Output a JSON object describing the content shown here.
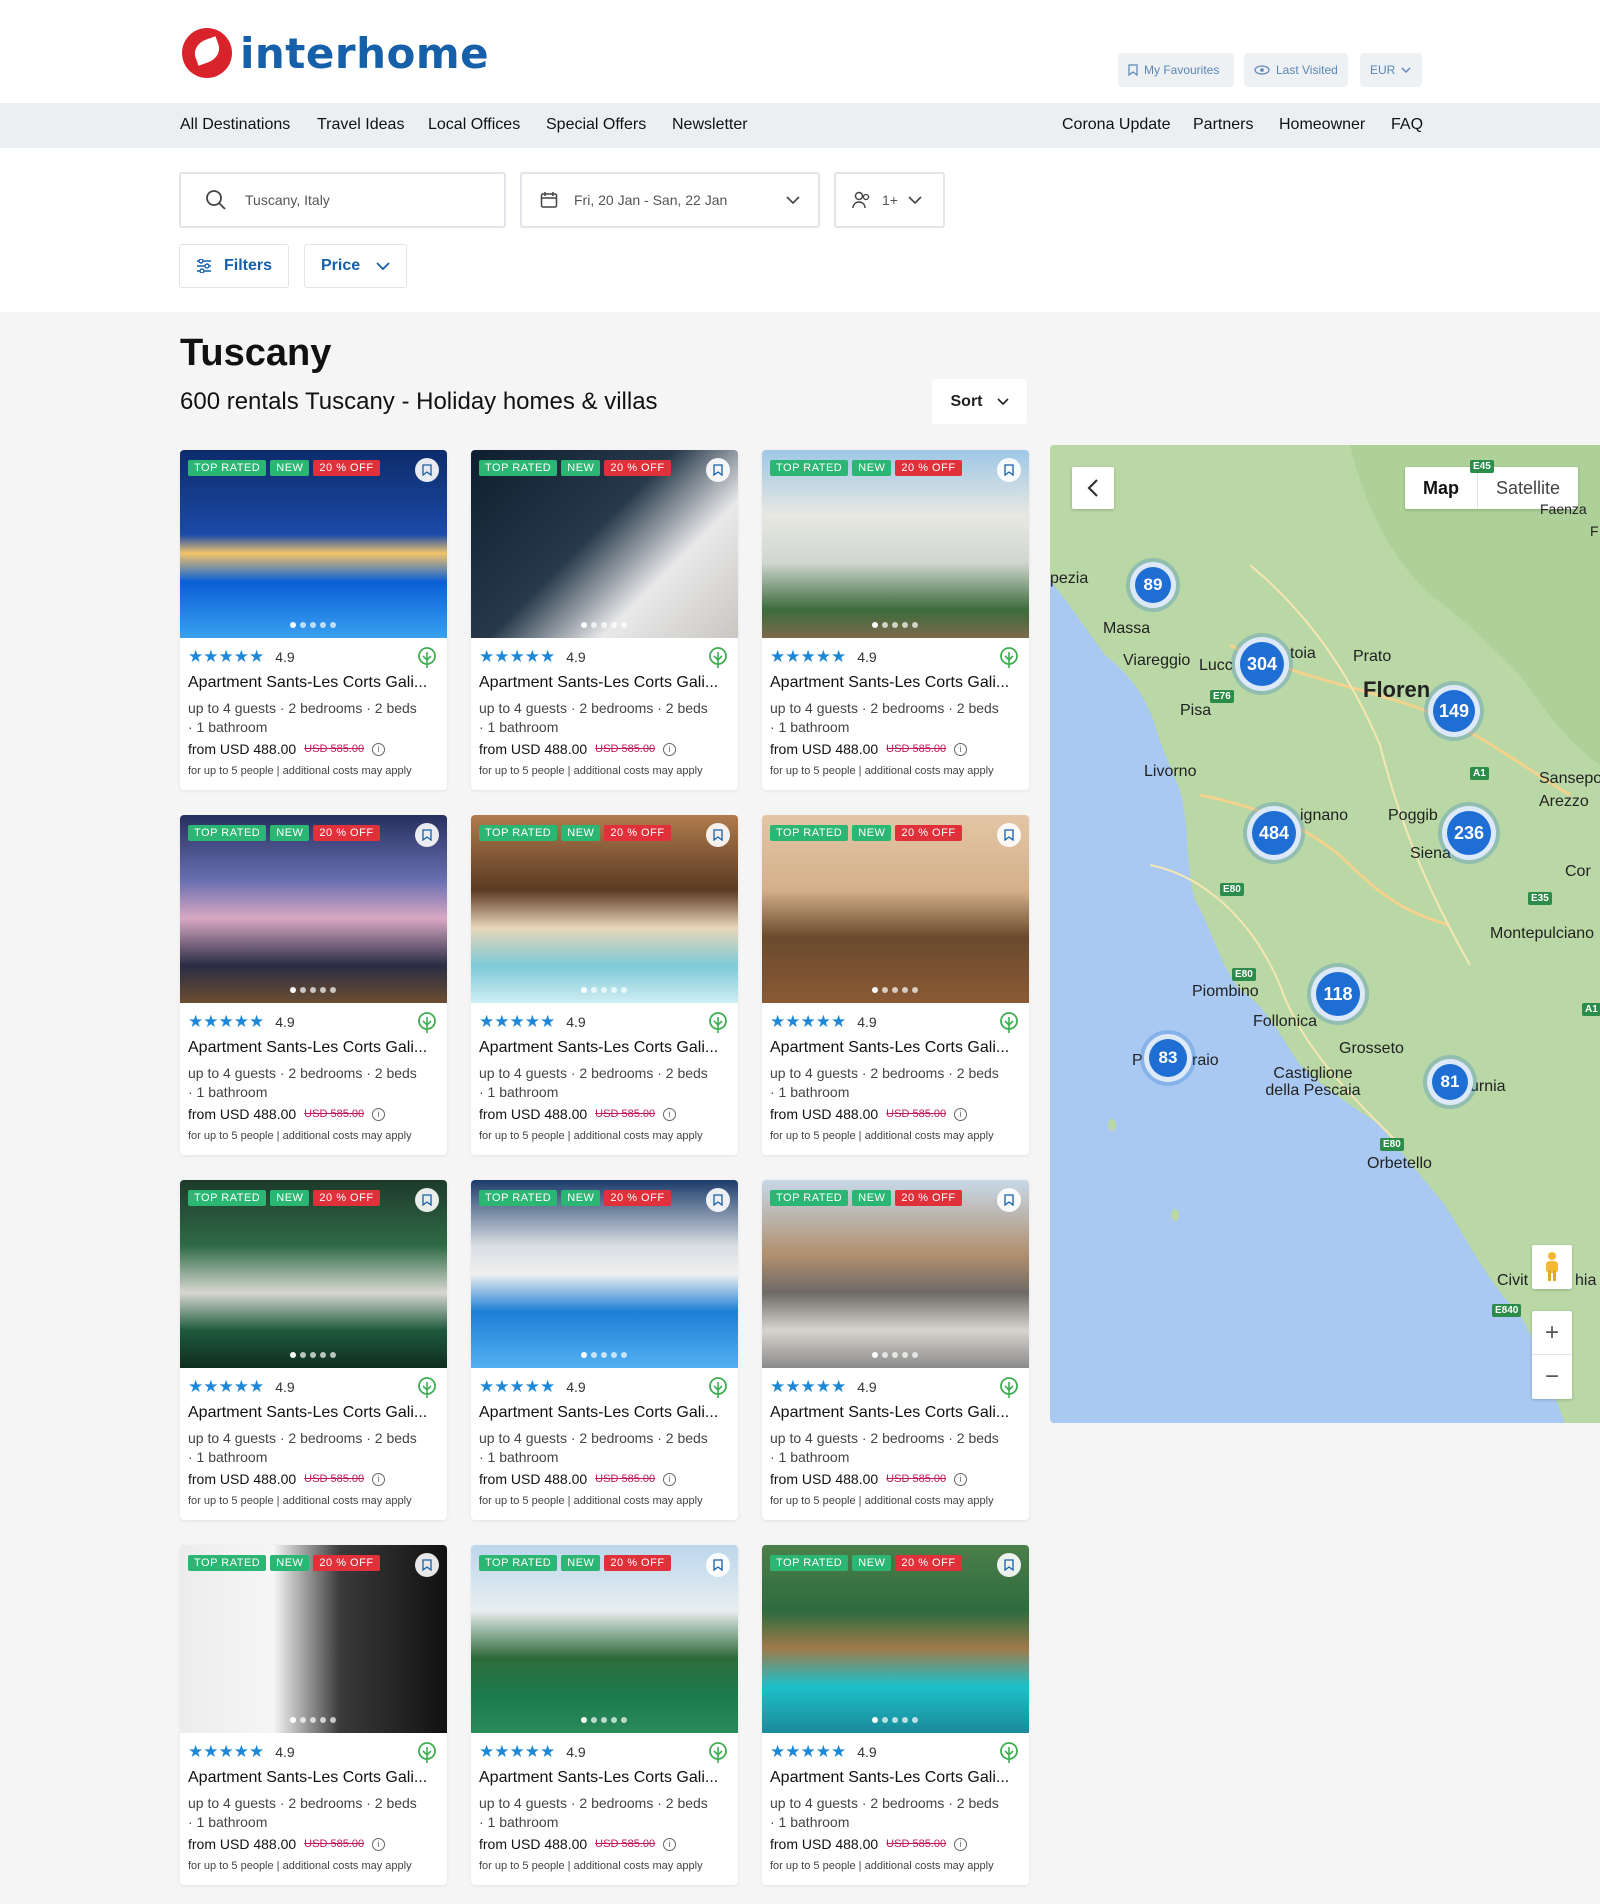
{
  "brand": {
    "name": "interhome"
  },
  "utility": {
    "favourites": "My Favourites",
    "last_visited": "Last Visited",
    "currency": "EUR"
  },
  "nav": {
    "left": [
      "All Destinations",
      "Travel Ideas",
      "Local Offices",
      "Special Offers",
      "Newsletter"
    ],
    "right": [
      "Corona Update",
      "Partners",
      "Homeowner",
      "FAQ"
    ]
  },
  "search": {
    "destination": "Tuscany, Italy",
    "dates": "Fri, 20 Jan - San, 22 Jan",
    "guests": "1+",
    "filters": "Filters",
    "price": "Price"
  },
  "page": {
    "title": "Tuscany",
    "subtitle": "600 rentals Tuscany - Holiday homes & villas",
    "sort": "Sort"
  },
  "card_template": {
    "badges": [
      "TOP RATED",
      "NEW",
      "20 % OFF"
    ],
    "stars": "★★★★★",
    "rating": "4.9",
    "name": "Apartment Sants-Les Corts Gali...",
    "details_line1": "up to 4 guests · 2 bedrooms · 2 beds",
    "details_line2": "· 1 bathroom",
    "price": "from USD 488.00",
    "old_price": "USD 585.00",
    "info": "i",
    "note": "for up to 5 people | additional costs may apply"
  },
  "colors": {
    "top_rated": "#2bb673",
    "new": "#2bb673",
    "discount": "#e0313b",
    "brand_blue": "#1560a8",
    "star": "#1e88d8",
    "cluster": "#1f6ed4"
  },
  "map": {
    "toggle": [
      "Map",
      "Satellite"
    ],
    "clusters": [
      "89",
      "304",
      "149",
      "484",
      "236",
      "118",
      "83",
      "81"
    ],
    "labels": [
      "pezia",
      "Massa",
      "Viareggio",
      "Lucc",
      "toia",
      "Prato",
      "Floren",
      "Pisa",
      "Livorno",
      "Sansepo",
      "Arezzo",
      "ignano",
      "Poggib",
      "Siena",
      "Cor",
      "Montepulciano",
      "Piombino",
      "Follonica",
      "Grosseto",
      "P",
      "raio",
      "Castiglione della Pescaia",
      "urnia",
      "Orbetello",
      "Civit",
      "hia",
      "Faenza",
      "F"
    ],
    "roads": [
      "E45",
      "E76",
      "A1",
      "E80",
      "E35",
      "E80",
      "A1",
      "E80",
      "E840"
    ],
    "zoom_in": "+",
    "zoom_out": "−"
  }
}
